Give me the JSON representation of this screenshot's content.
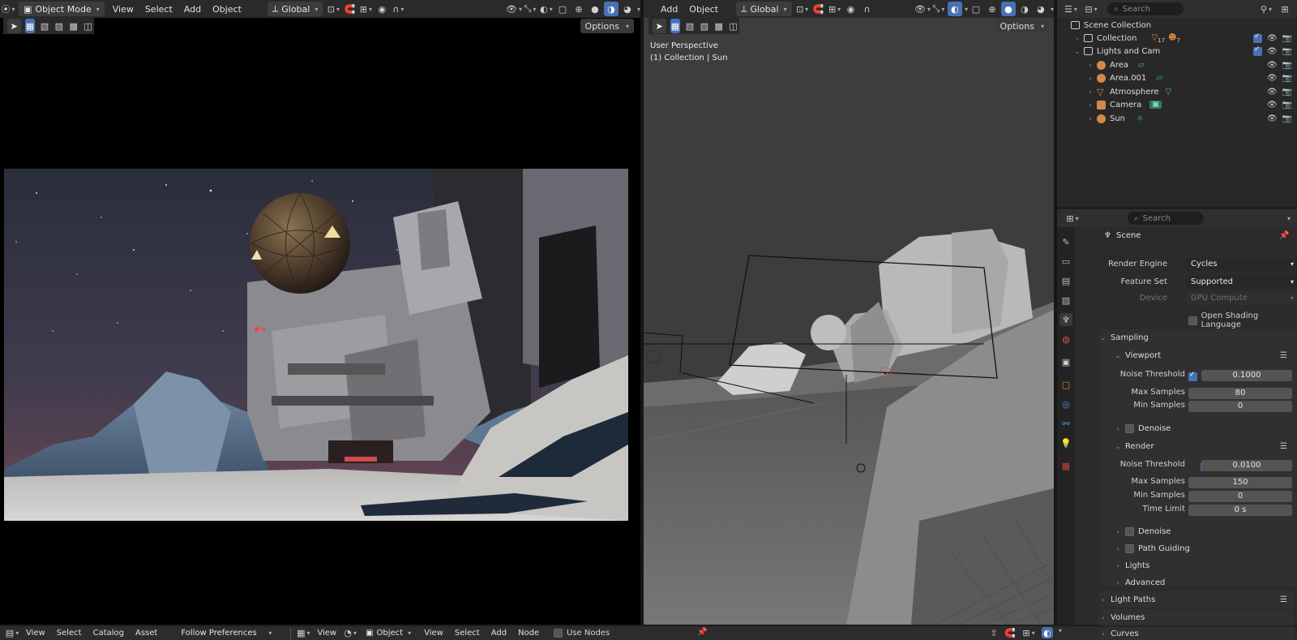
{
  "left_viewport": {
    "mode": "Object Mode",
    "menus": [
      "View",
      "Select",
      "Add",
      "Object"
    ],
    "orientation": "Global",
    "options": "Options"
  },
  "mid_viewport": {
    "menus": [
      "Add",
      "Object"
    ],
    "orientation": "Global",
    "options": "Options",
    "perspective": "User Perspective",
    "context": "(1) Collection | Sun"
  },
  "outliner": {
    "search_placeholder": "Search",
    "scene_collection": "Scene Collection",
    "items": [
      {
        "label": "Collection",
        "badge1": "17",
        "badge2": "7"
      },
      {
        "label": "Lights and Cam"
      },
      {
        "label": "Area"
      },
      {
        "label": "Area.001"
      },
      {
        "label": "Atmosphere"
      },
      {
        "label": "Camera"
      },
      {
        "label": "Sun"
      }
    ]
  },
  "properties": {
    "search_placeholder": "Search",
    "scene": "Scene",
    "render_engine_label": "Render Engine",
    "render_engine": "Cycles",
    "feature_set_label": "Feature Set",
    "feature_set": "Supported",
    "device_label": "Device",
    "device": "GPU Compute",
    "osl": "Open Shading Language",
    "sampling": "Sampling",
    "viewport": "Viewport",
    "vp_noise_label": "Noise Threshold",
    "vp_noise": "0.1000",
    "vp_max_label": "Max Samples",
    "vp_max": "80",
    "vp_min_label": "Min Samples",
    "vp_min": "0",
    "denoise": "Denoise",
    "render": "Render",
    "r_noise_label": "Noise Threshold",
    "r_noise": "0.0100",
    "r_max_label": "Max Samples",
    "r_max": "150",
    "r_min_label": "Min Samples",
    "r_min": "0",
    "time_limit_label": "Time Limit",
    "time_limit": "0 s",
    "denoise2": "Denoise",
    "path_guiding": "Path Guiding",
    "lights": "Lights",
    "advanced": "Advanced",
    "light_paths": "Light Paths",
    "volumes": "Volumes",
    "curves": "Curves"
  },
  "bottom_bar": {
    "left_menus": [
      "View",
      "Select",
      "Catalog",
      "Asset"
    ],
    "follow": "Follow Preferences",
    "node_view": "View",
    "object": "Object",
    "node_menus": [
      "View",
      "Select",
      "Add",
      "Node"
    ],
    "use_nodes": "Use Nodes"
  },
  "colors": {
    "accent": "#4772b3",
    "header": "#303030",
    "panel": "#2b2b2b",
    "viewport_bg": "#3d3d3d"
  }
}
